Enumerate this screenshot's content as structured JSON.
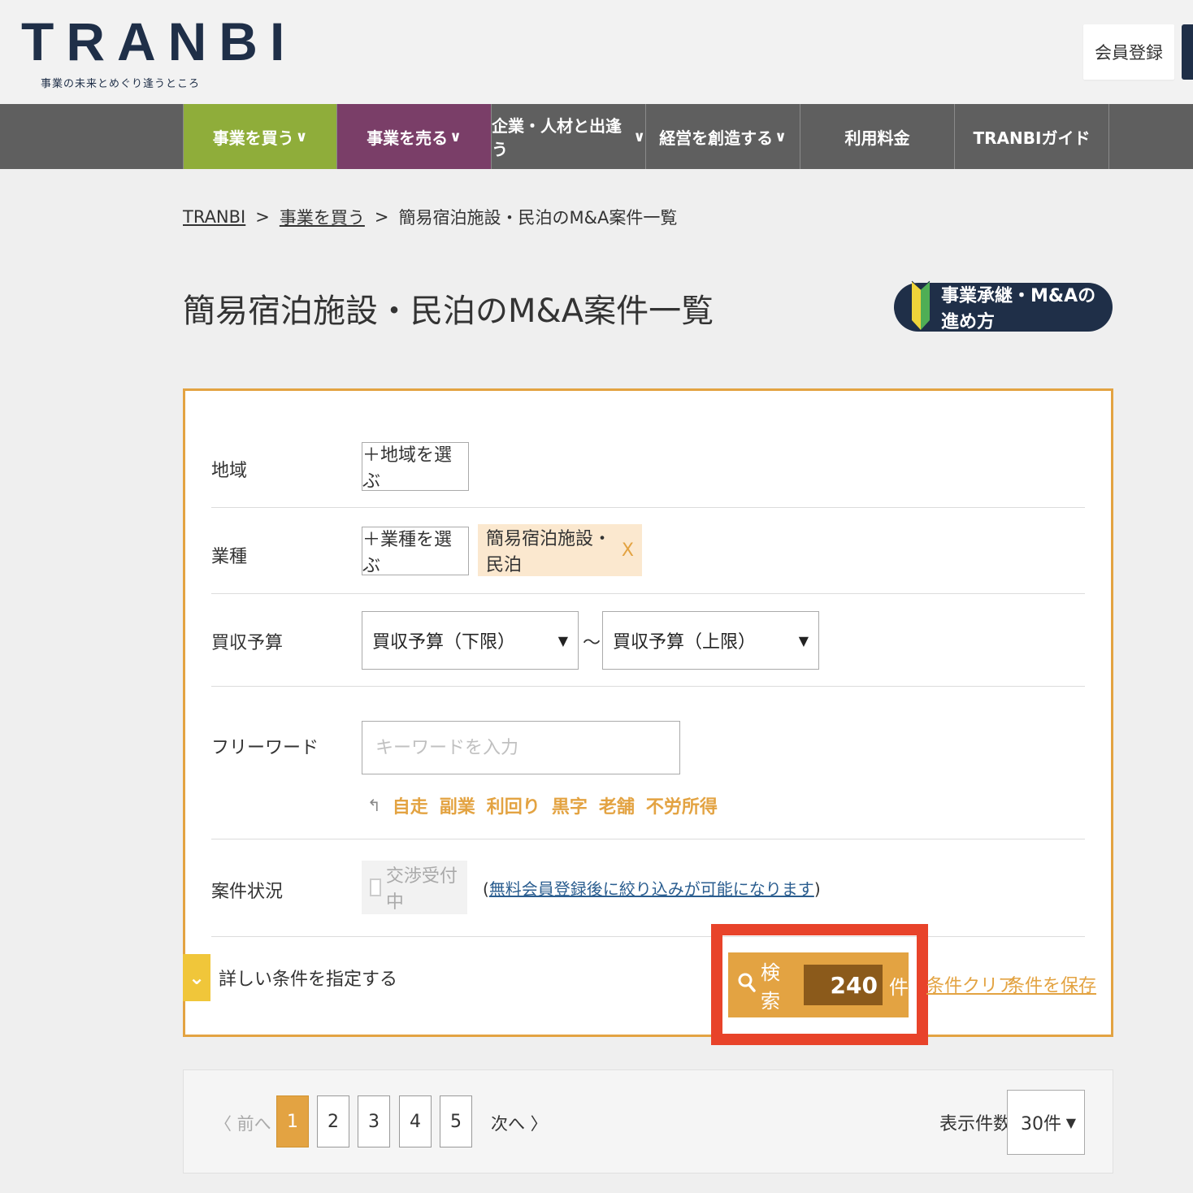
{
  "header": {
    "logo_text": "TRANBI",
    "tagline": "事業の未来とめぐり逢うところ",
    "signup_label": "会員登録"
  },
  "nav": {
    "items": [
      {
        "label": "事業を買う"
      },
      {
        "label": "事業を売る"
      },
      {
        "label": "企業・人材と出逢う"
      },
      {
        "label": "経営を創造する"
      },
      {
        "label": "利用料金"
      },
      {
        "label": "TRANBIガイド"
      }
    ],
    "caret": "∨"
  },
  "breadcrumb": {
    "items": [
      "TRANBI",
      "事業を買う",
      "簡易宿泊施設・民泊のM&A案件一覧"
    ],
    "separator": ">"
  },
  "page": {
    "title": "簡易宿泊施設・民泊のM&A案件一覧",
    "guide_button": "事業承継・M&Aの進め方"
  },
  "search": {
    "region_label": "地域",
    "region_button": "＋地域を選ぶ",
    "industry_label": "業種",
    "industry_button": "＋業種を選ぶ",
    "industry_selected": "簡易宿泊施設・民泊",
    "industry_remove": "X",
    "budget_label": "買収予算",
    "budget_min": "買収予算（下限）",
    "budget_max": "買収予算（上限）",
    "budget_sep": "～",
    "freeword_label": "フリーワード",
    "freeword_placeholder": "キーワードを入力",
    "freeword_value": "",
    "keywords": [
      "自走",
      "副業",
      "利回り",
      "黒字",
      "老舗",
      "不労所得"
    ],
    "status_label": "案件状況",
    "status_option": "交渉受付中",
    "status_note_link": "無料会員登録後に絞り込みが可能になります",
    "detail_toggle": "詳しい条件を指定する",
    "search_button": "検索",
    "result_count": "240",
    "result_unit": "件",
    "clear_link": "条件クリア",
    "save_link": "条件を保存"
  },
  "pagination": {
    "prev": "〈 前へ",
    "pages": [
      "1",
      "2",
      "3",
      "4",
      "5"
    ],
    "current": "1",
    "next": "次へ 〉",
    "per_page_label": "表示件数",
    "per_page_value": "30件"
  },
  "colors": {
    "brand_navy": "#1f2f48",
    "nav_buy": "#8fad3a",
    "nav_sell": "#7a3e68",
    "accent_orange": "#e3a342",
    "highlight_red": "#e8432a"
  }
}
